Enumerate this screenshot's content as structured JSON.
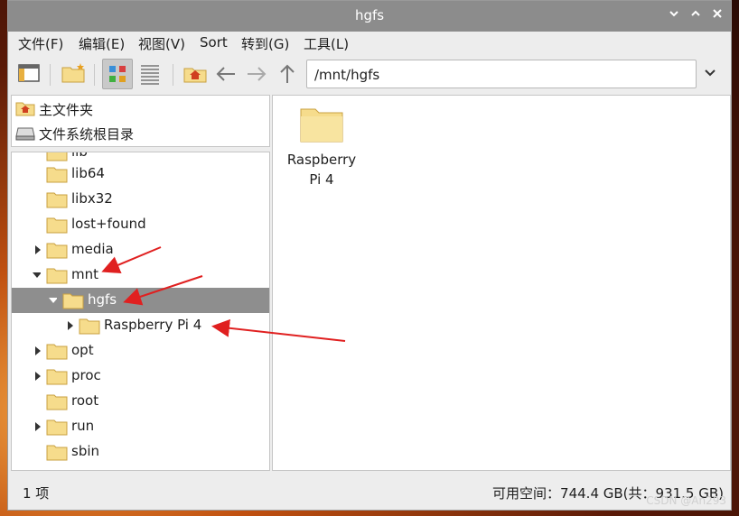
{
  "window": {
    "title": "hgfs",
    "controls": [
      "chevron-down",
      "chevron-up",
      "close"
    ]
  },
  "menubar": {
    "items": [
      "文件(F)",
      "编辑(E)",
      "视图(V)",
      "Sort",
      "转到(G)",
      "工具(L)"
    ]
  },
  "toolbar": {
    "buttons": [
      "new-window-icon",
      "new-folder-icon",
      "icon-view-icon",
      "list-view-icon",
      "home-icon",
      "back-arrow-icon",
      "forward-arrow-icon",
      "up-arrow-icon"
    ],
    "path_value": "/mnt/hgfs"
  },
  "places": [
    {
      "label": "主文件夹",
      "icon": "home-folder-icon"
    },
    {
      "label": "文件系统根目录",
      "icon": "drive-icon"
    }
  ],
  "tree": [
    {
      "label": "lib",
      "expander": "",
      "partial": true
    },
    {
      "label": "lib64",
      "expander": ""
    },
    {
      "label": "libx32",
      "expander": ""
    },
    {
      "label": "lost+found",
      "expander": ""
    },
    {
      "label": "media",
      "expander": "collapsed"
    },
    {
      "label": "mnt",
      "expander": "expanded"
    },
    {
      "label": "hgfs",
      "expander": "expanded",
      "selected": true
    },
    {
      "label": "Raspberry Pi 4",
      "expander": "collapsed"
    },
    {
      "label": "opt",
      "expander": "collapsed"
    },
    {
      "label": "proc",
      "expander": "collapsed"
    },
    {
      "label": "root",
      "expander": ""
    },
    {
      "label": "run",
      "expander": "collapsed"
    },
    {
      "label": "sbin",
      "expander": ""
    }
  ],
  "content": {
    "items": [
      {
        "label_line1": "Raspberry",
        "label_line2": "Pi 4",
        "icon": "folder-icon"
      }
    ]
  },
  "status": {
    "count": "1 项",
    "free_space": "可用空间：744.4 GB(共：931.5 GB)"
  },
  "watermark": "CSDN @An293",
  "colors": {
    "titlebar": "#8c8c8c",
    "selection": "#8e8e8e",
    "folder": "#f6dc8c",
    "annotation_arrow": "#e02020"
  }
}
